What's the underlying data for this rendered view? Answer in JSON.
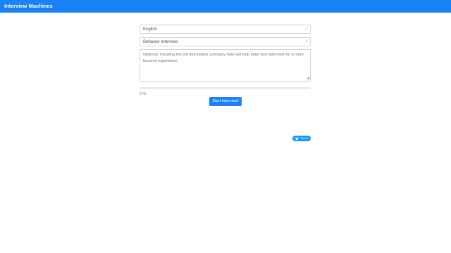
{
  "navbar": {
    "brand": "Interview Machines",
    "color": "#1a82f7"
  },
  "form": {
    "language": {
      "selected": "English"
    },
    "interview_type": {
      "selected": "Behavior Interview"
    },
    "job_description": {
      "value": "",
      "placeholder": "Optional: Inputting the job description summary here will help tailor your interview for a more focused experience."
    },
    "progress": {
      "percent": 0,
      "label": "0 %"
    },
    "start_label": "Start Interview!"
  },
  "share": {
    "tweet_label": "Tweet",
    "icon": "twitter-bird-icon"
  },
  "icons": {
    "select_arrow": "select-arrows-icon",
    "resize": "resize-grip-icon"
  }
}
